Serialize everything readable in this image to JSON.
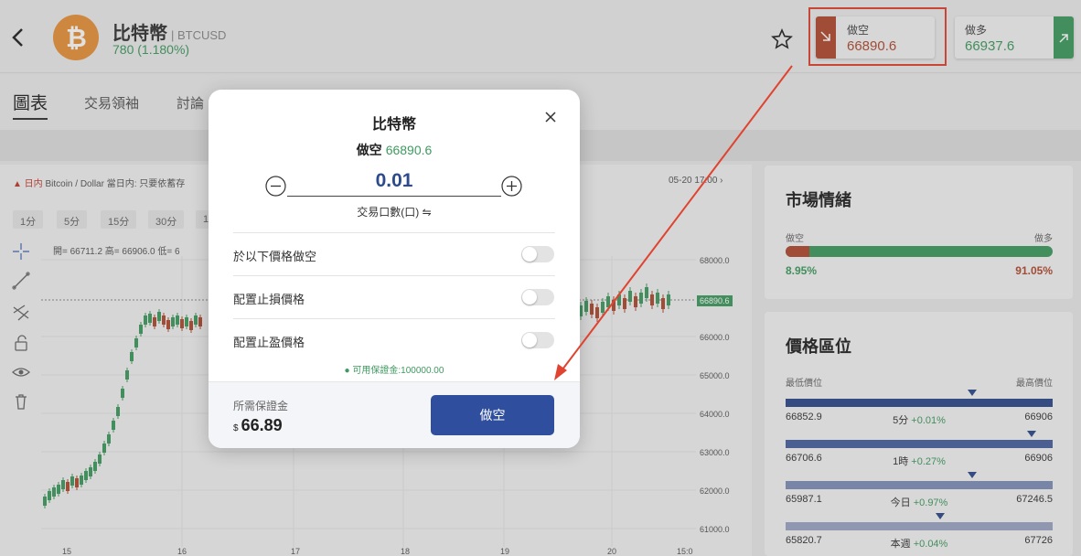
{
  "header": {
    "coin_name": "比特幣",
    "symbol": "| BTCUSD",
    "change": "780 (1.180%)",
    "short_label": "做空",
    "short_price": "66890.6",
    "long_label": "做多",
    "long_price": "66937.6"
  },
  "tabs": [
    "圖表",
    "交易領袖",
    "討論"
  ],
  "chart": {
    "info_prefix": "▲ 日内",
    "info_text": "Bitcoin / Dollar 當日内: 只要依蓄存",
    "date_label": "05-20 17:00 ›",
    "timeframes": [
      "1分",
      "5分",
      "15分",
      "30分",
      "1"
    ],
    "ohlc": "開= 66711.2  高= 66906.0  低= 6",
    "y_ticks": [
      "68000.0",
      "67000.0",
      "66000.0",
      "65000.0",
      "64000.0",
      "63000.0",
      "62000.0",
      "61000.0"
    ],
    "last_price": "66890.6",
    "x_ticks": [
      "15",
      "16",
      "17",
      "18",
      "19",
      "20",
      "15:0"
    ]
  },
  "sentiment": {
    "title": "市場情緒",
    "short_label": "做空",
    "long_label": "做多",
    "short_pct": "8.95%",
    "long_pct": "91.05%",
    "short_fraction": 0.0895,
    "short_color": "#b04a2f",
    "long_color": "#3e9a5f"
  },
  "price_range": {
    "title": "價格區位",
    "low_label": "最低價位",
    "high_label": "最高價位",
    "rows": [
      {
        "low": "66852.9",
        "period": "5分",
        "change": "+0.01%",
        "high": "66906",
        "marker": 0.7
      },
      {
        "low": "66706.6",
        "period": "1時",
        "change": "+0.27%",
        "high": "66906",
        "marker": 0.92
      },
      {
        "low": "65987.1",
        "period": "今日",
        "change": "+0.97%",
        "high": "67246.5",
        "marker": 0.7
      },
      {
        "low": "65820.7",
        "period": "本週",
        "change": "+0.04%",
        "high": "67726",
        "marker": 0.58
      }
    ]
  },
  "modal": {
    "title": "比特幣",
    "action_label": "做空",
    "action_price": "66890.6",
    "quantity": "0.01",
    "unit_label": "交易口數(口)  ⇋",
    "options": [
      "於以下價格做空",
      "配置止損價格",
      "配置止盈價格"
    ],
    "available": "可用保證金:100000.00",
    "required_label": "所需保證金",
    "currency": "$",
    "required_value": "66.89",
    "submit_label": "做空"
  }
}
